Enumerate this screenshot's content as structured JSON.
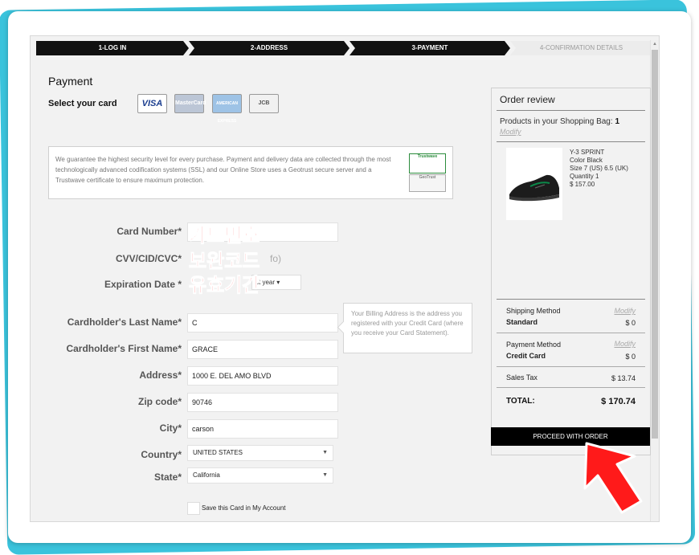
{
  "steps": [
    {
      "label": "1-LOG IN"
    },
    {
      "label": "2-ADDRESS"
    },
    {
      "label": "3-PAYMENT"
    },
    {
      "label": "4-CONFIRMATION DETAILS"
    }
  ],
  "payment": {
    "title": "Payment",
    "select_card_label": "Select your card",
    "cards": [
      "VISA",
      "MasterCard",
      "AMERICAN EXPRESS",
      "JCB"
    ],
    "security_text": "We guarantee the highest security level for every purchase. Payment and delivery data are collected through the most technologically advanced codification systems (SSL) and our Online Store uses a Geotrust secure server and a Trustwave certificate to ensure maximum protection.",
    "badges": [
      "Trustwave",
      "GeoTrust"
    ]
  },
  "form": {
    "card_number_label": "Card Number*",
    "cvv_label": "CVV/CID/CVC*",
    "cvv_info": "fo)",
    "expiration_label": "Expiration Date *",
    "year_select": "ct year",
    "last_name_label": "Cardholder's Last Name*",
    "last_name_value": "C",
    "first_name_label": "Cardholder's First Name*",
    "first_name_value": "GRACE",
    "address_label": "Address*",
    "address_value": "1000 E. DEL AMO BLVD",
    "zip_label": "Zip code*",
    "zip_value": "90746",
    "city_label": "City*",
    "city_value": "carson",
    "country_label": "Country*",
    "country_value": "UNITED STATES",
    "state_label": "State*",
    "state_value": "California",
    "save_card_label": "Save this Card in My Account",
    "billing_tip": "Your Billing Address is the address you registered with your Credit Card (where you receive your Card Statement)."
  },
  "annotations": {
    "card_number": "카드번호",
    "cvv": "보완코드",
    "expiration": "유효기간"
  },
  "order": {
    "title": "Order review",
    "bag_text": "Products in your Shopping Bag:",
    "bag_count": "1",
    "modify": "Modify",
    "product": {
      "name": "Y-3 SPRINT",
      "color": "Color Black",
      "size": "Size 7 (US) 6.5 (UK)",
      "quantity": "Quantity 1",
      "price": "$ 157.00"
    },
    "shipping_method_label": "Shipping Method",
    "shipping_method_value": "Standard",
    "shipping_cost": "$ 0",
    "payment_method_label": "Payment Method",
    "payment_method_value": "Credit Card",
    "payment_cost": "$ 0",
    "sales_tax_label": "Sales Tax",
    "sales_tax_value": "$ 13.74",
    "total_label": "TOTAL:",
    "total_value": "$ 170.74",
    "proceed_label": "PROCEED WITH ORDER"
  },
  "colors": {
    "accent_cyan": "#3ac3dc",
    "annotation_red": "#ff1515",
    "bar_black": "#111111"
  }
}
